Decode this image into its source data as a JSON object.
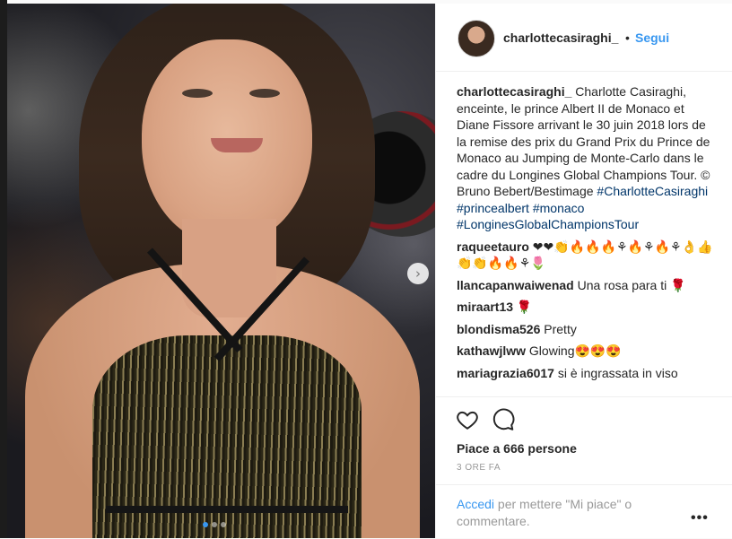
{
  "post": {
    "username": "charlottecasiraghi_",
    "separator": "•",
    "follow_label": "Segui",
    "caption_user": "charlottecasiraghi_",
    "caption_text": " Charlotte Casiraghi, enceinte, le prince Albert II de Monaco et Diane Fissore arrivant le 30 juin 2018 lors de la remise des prix du Grand Prix du Prince de Monaco au Jumping de Monte-Carlo dans le cadre du Longines Global Champions Tour. © Bruno Bebert/Bestimage ",
    "hashtags": [
      "#CharlotteCasiraghi",
      "#princealbert",
      "#monaco",
      "#LonginesGlobalChampionsTour"
    ]
  },
  "comments": [
    {
      "user": "raqueetauro",
      "text": " ❤❤👏🔥🔥🔥⚘🔥⚘🔥⚘👌👍👏👏🔥🔥⚘🌷"
    },
    {
      "user": "llancapanwaiwenad",
      "text": " Una rosa para ti 🌹"
    },
    {
      "user": "miraart13",
      "text": " 🌹"
    },
    {
      "user": "blondisma526",
      "text": " Pretty"
    },
    {
      "user": "kathawjlww",
      "text": " Glowing😍😍😍"
    },
    {
      "user": "mariagrazia6017",
      "text": " si è ingrassata in viso"
    }
  ],
  "footer": {
    "likes": "Piace a 666 persone",
    "time": "3 ORE FA",
    "login_link": "Accedi",
    "login_rest": " per mettere \"Mi piace\" o commentare.",
    "more_label": "•••"
  },
  "carousel": {
    "next_icon": "›",
    "dots": 3,
    "active_dot": 0
  }
}
